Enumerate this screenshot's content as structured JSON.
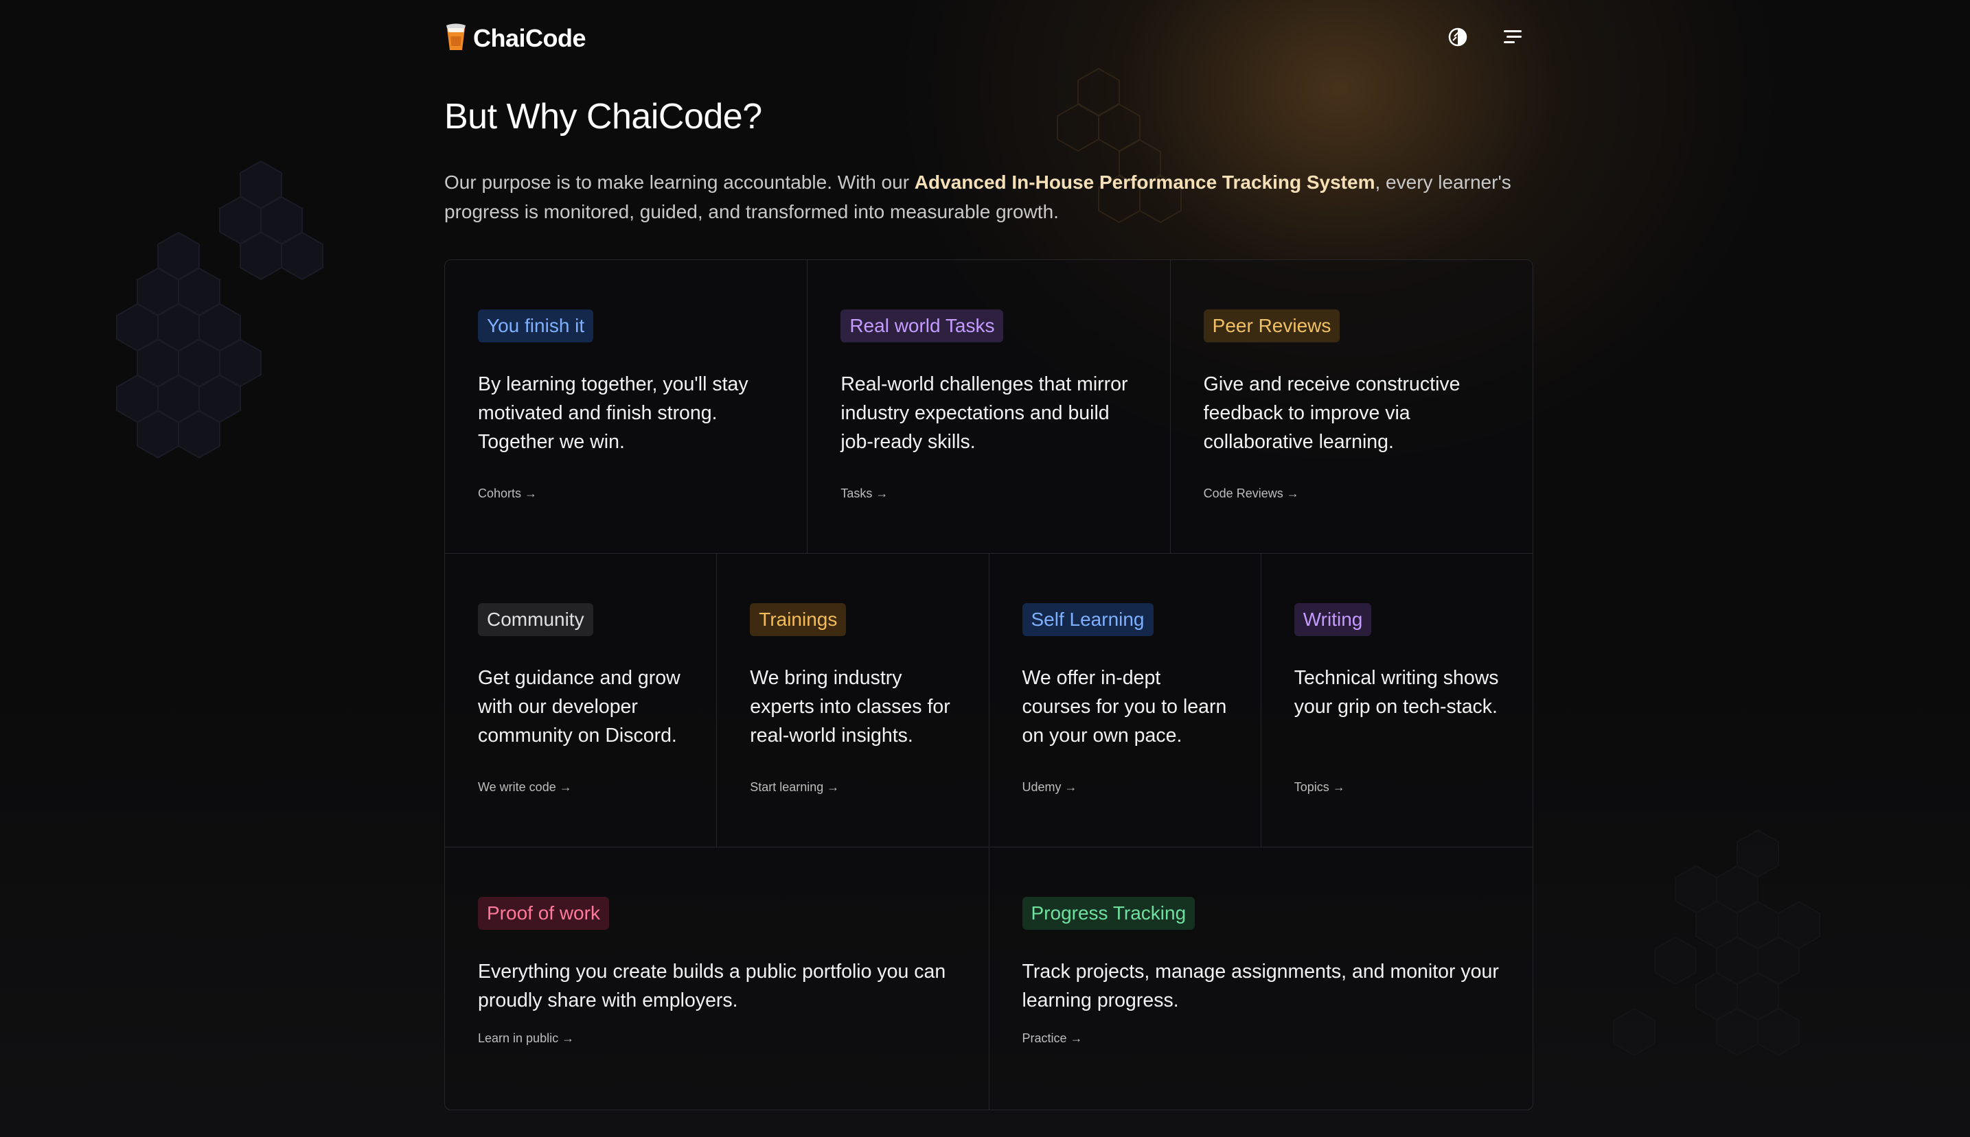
{
  "header": {
    "logo_text": "ChaiCode",
    "logo_icon": "chai-cup-icon",
    "theme_toggle_icon": "contrast-icon",
    "menu_icon": "hamburger-menu-icon"
  },
  "section": {
    "title": "But Why ChaiCode?",
    "intro_before": "Our purpose is to make learning accountable. With our ",
    "intro_highlight": "Advanced In-House Performance Tracking System",
    "intro_after": ", every learner's progress is monitored, guided, and transformed into measurable growth."
  },
  "cards": [
    {
      "badge": "You finish it",
      "text": "By learning together, you'll stay motivated and finish strong. Together we win.",
      "link": "Cohorts →",
      "badge_color": "#7fb0ff",
      "badge_bg": "#13284a"
    },
    {
      "badge": "Real world Tasks",
      "text": "Real-world challenges that mirror industry expectations and build job-ready skills.",
      "link": "Tasks →",
      "badge_color": "#c49bff",
      "badge_bg": "#2e2140"
    },
    {
      "badge": "Peer Reviews",
      "text": "Give and receive constructive feedback to improve via collaborative learning.",
      "link": "Code Reviews →",
      "badge_color": "#f0c064",
      "badge_bg": "#3a2a12"
    },
    {
      "badge": "Community",
      "text": "Get guidance and grow with our developer community on Discord.",
      "link": "We write code →",
      "badge_color": "#e0e0e0",
      "badge_bg": "#232326"
    },
    {
      "badge": "Trainings",
      "text": "We bring industry experts into classes for real-world insights.",
      "link": "Start learning →",
      "badge_color": "#f5bd58",
      "badge_bg": "#3d2a10"
    },
    {
      "badge": "Self Learning",
      "text": "We offer in-dept courses for you to learn on your own pace.",
      "link": "Udemy →",
      "badge_color": "#7fb0ff",
      "badge_bg": "#13284a"
    },
    {
      "badge": "Writing",
      "text": "Technical writing shows your grip on tech-stack.",
      "link": "Topics →",
      "badge_color": "#c49bff",
      "badge_bg": "#2a1d3c"
    },
    {
      "badge": "Proof of work",
      "text": "Everything you create builds a public portfolio you can proudly share with employers.",
      "link": "Learn in public →",
      "badge_color": "#ff7a9a",
      "badge_bg": "#3d1420"
    },
    {
      "badge": "Progress Tracking",
      "text": "Track projects, manage assignments, and monitor your learning progress.",
      "link": "Practice →",
      "badge_color": "#6fe0a0",
      "badge_bg": "#14321f"
    }
  ]
}
